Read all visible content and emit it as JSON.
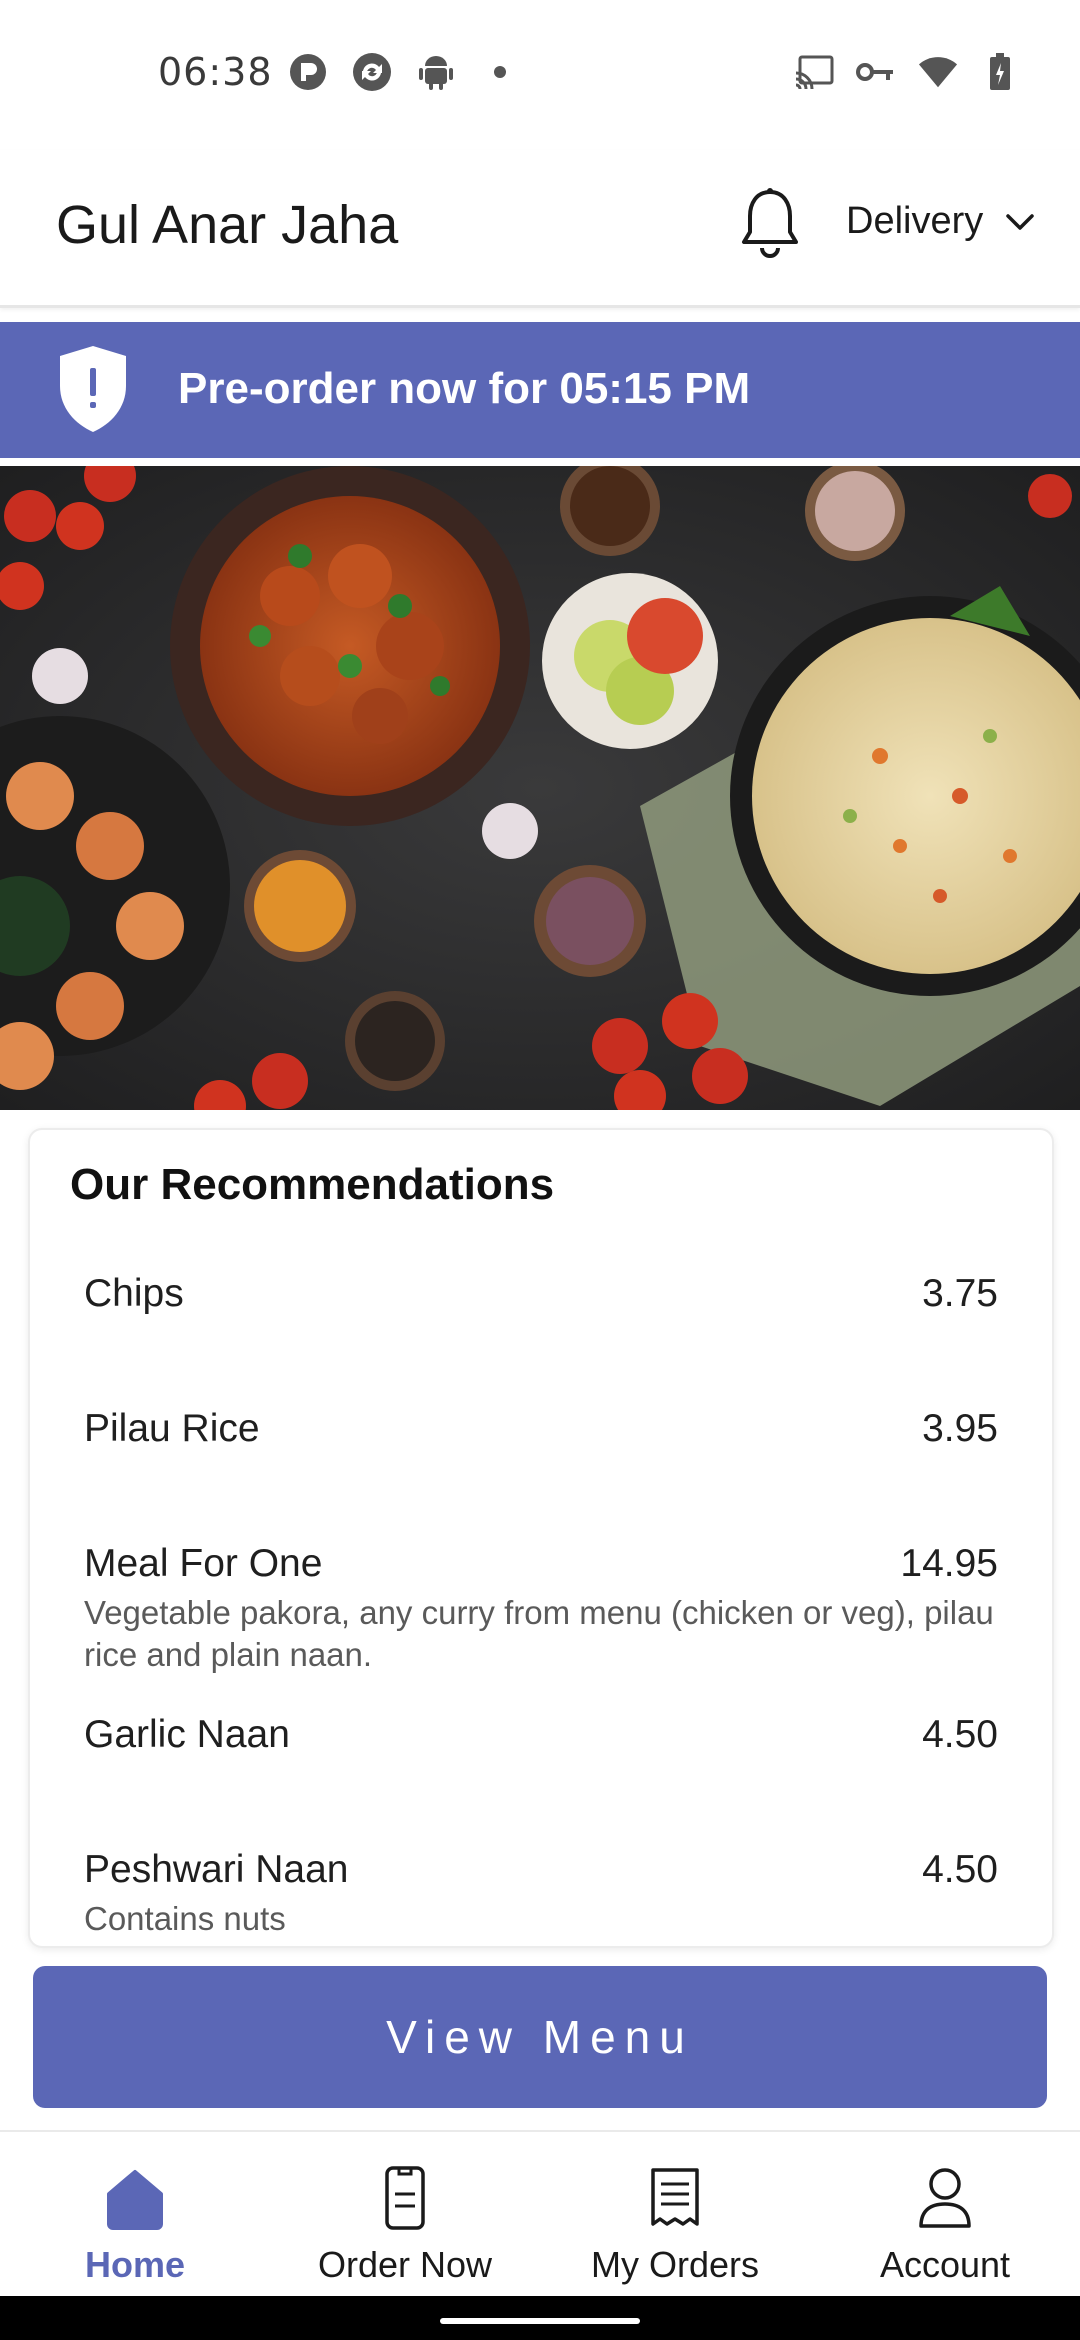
{
  "status_bar": {
    "time": "06:38",
    "left_icons": [
      "p-badge-icon",
      "sync-icon",
      "android-icon",
      "dot-icon"
    ],
    "right_icons": [
      "cast-icon",
      "key-icon",
      "wifi-icon",
      "battery-icon"
    ]
  },
  "header": {
    "title": "Gul Anar Jaha",
    "notification_icon": "bell-icon",
    "delivery_mode": "Delivery"
  },
  "banner": {
    "text": "Pre-order now for 05:15 PM",
    "icon": "shield-alert-icon",
    "color": "#5b67b6"
  },
  "recommendations": {
    "title": "Our Recommendations",
    "items": [
      {
        "name": "Chips",
        "price": "3.75",
        "description": ""
      },
      {
        "name": "Pilau Rice",
        "price": "3.95",
        "description": ""
      },
      {
        "name": "Meal For One",
        "price": "14.95",
        "description": "Vegetable pakora, any curry from menu (chicken or veg), pilau rice and plain naan."
      },
      {
        "name": "Garlic Naan",
        "price": "4.50",
        "description": ""
      },
      {
        "name": "Peshwari Naan",
        "price": "4.50",
        "description": "Contains nuts"
      }
    ]
  },
  "view_menu_label": "View Menu",
  "bottom_nav": {
    "items": [
      {
        "label": "Home",
        "icon": "home-icon",
        "active": true
      },
      {
        "label": "Order Now",
        "icon": "mobile-order-icon",
        "active": false
      },
      {
        "label": "My Orders",
        "icon": "receipt-icon",
        "active": false
      },
      {
        "label": "Account",
        "icon": "person-icon",
        "active": false
      }
    ]
  },
  "colors": {
    "accent": "#5b67b6",
    "text": "#1a1a1a",
    "muted": "#5a5a5a"
  }
}
